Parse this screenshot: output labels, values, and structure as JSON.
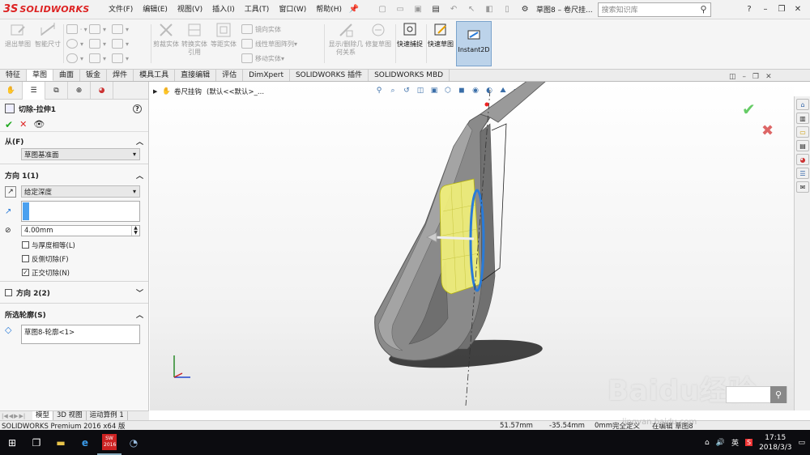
{
  "app": {
    "logo_ds": "3S",
    "logo_text": "SOLIDWORKS",
    "menus": [
      "文件(F)",
      "编辑(E)",
      "视图(V)",
      "插入(I)",
      "工具(T)",
      "窗口(W)",
      "帮助(H)"
    ],
    "doc_title": "草图8 – 卷尺挂...",
    "search_placeholder": "搜索知识库"
  },
  "ribbon": {
    "exit_sketch": "退出草图",
    "smart_dim": "智能尺寸",
    "mirror": "镜向实体",
    "linear_pattern": "线性草图阵列",
    "move": "移动实体",
    "trim": "剪裁实体",
    "convert": "转换实体引用",
    "offset": "等距实体",
    "display_rel": "显示/删除几何关系",
    "repair": "修复草图",
    "quick_snap": "快速捕捉",
    "rapid_sketch": "快速草图",
    "instant2d": "Instant2D"
  },
  "tabs": [
    "特征",
    "草图",
    "曲面",
    "钣金",
    "焊件",
    "模具工具",
    "直接编辑",
    "评估",
    "DimXpert",
    "SOLIDWORKS 插件",
    "SOLIDWORKS MBD"
  ],
  "active_tab": "草图",
  "panel": {
    "feature_title": "切除-拉伸1",
    "from_label": "从(F)",
    "from_value": "草图基准面",
    "dir1_label": "方向 1(1)",
    "dir1_end": "给定深度",
    "depth": "4.00mm",
    "opt_equal_thickness": "与厚度相等(L)",
    "opt_flip": "反侧切除(F)",
    "opt_normal": "正交切除(N)",
    "normal_checked": "✓",
    "dir2_label": "方向 2(2)",
    "contours_label": "所选轮廓(S)",
    "contour_item": "草图8-轮廓<1>"
  },
  "bottom_tabs": [
    "模型",
    "3D 视图",
    "运动算例 1"
  ],
  "status": {
    "product": "SOLIDWORKS Premium 2016 x64 版",
    "x": "51.57mm",
    "y": "-35.54mm",
    "z": "0mm",
    "state": "完全定义",
    "editing": "在编辑 草图8"
  },
  "viewport": {
    "tree_root": "卷尺挂钩",
    "tree_config": "(默认<<默认>_..."
  },
  "taskbar": {
    "sw_label": "SW 2016",
    "ime": "英",
    "time": "17:15",
    "date": "2018/3/3"
  },
  "watermark": {
    "brand": "Baidu经验",
    "url": "jingyan.baidu.com"
  },
  "colors": {
    "accent_red": "#d22222",
    "instant2d_bg": "#bcd3ea",
    "part_gray": "#8a8a8a",
    "sketch_blue": "#2a7bd8",
    "preview_yellow": "#f2f07a"
  }
}
